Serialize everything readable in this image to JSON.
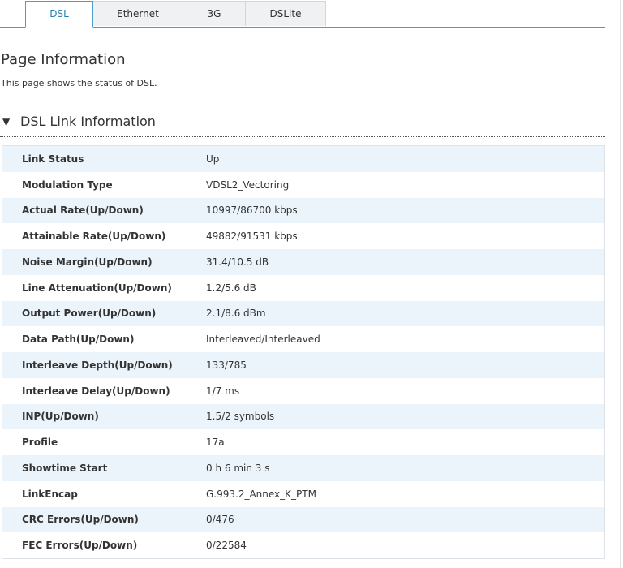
{
  "tabs": [
    {
      "label": "DSL",
      "active": true
    },
    {
      "label": "Ethernet",
      "active": false
    },
    {
      "label": "3G",
      "active": false
    },
    {
      "label": "DSLite",
      "active": false
    }
  ],
  "page": {
    "title": "Page Information",
    "description": "This page shows the status of DSL."
  },
  "section": {
    "toggle_icon": "triangle-down-icon",
    "toggle_glyph": "▼",
    "title": "DSL Link Information"
  },
  "colors": {
    "accent": "#4a9fc8",
    "row_alt": "#ebf4fb"
  },
  "rows": [
    {
      "label": "Link Status",
      "value": "Up"
    },
    {
      "label": "Modulation Type",
      "value": "VDSL2_Vectoring"
    },
    {
      "label": "Actual Rate(Up/Down)",
      "value": "10997/86700 kbps"
    },
    {
      "label": "Attainable Rate(Up/Down)",
      "value": "49882/91531 kbps"
    },
    {
      "label": "Noise Margin(Up/Down)",
      "value": "31.4/10.5 dB"
    },
    {
      "label": "Line Attenuation(Up/Down)",
      "value": "1.2/5.6 dB"
    },
    {
      "label": "Output Power(Up/Down)",
      "value": "2.1/8.6 dBm"
    },
    {
      "label": "Data Path(Up/Down)",
      "value": "Interleaved/Interleaved"
    },
    {
      "label": "Interleave Depth(Up/Down)",
      "value": "133/785"
    },
    {
      "label": "Interleave Delay(Up/Down)",
      "value": "1/7 ms"
    },
    {
      "label": "INP(Up/Down)",
      "value": "1.5/2 symbols"
    },
    {
      "label": "Profile",
      "value": "17a"
    },
    {
      "label": "Showtime Start",
      "value": "0 h 6 min 3 s"
    },
    {
      "label": "LinkEncap",
      "value": "G.993.2_Annex_K_PTM"
    },
    {
      "label": "CRC Errors(Up/Down)",
      "value": "0/476"
    },
    {
      "label": "FEC Errors(Up/Down)",
      "value": "0/22584"
    }
  ]
}
